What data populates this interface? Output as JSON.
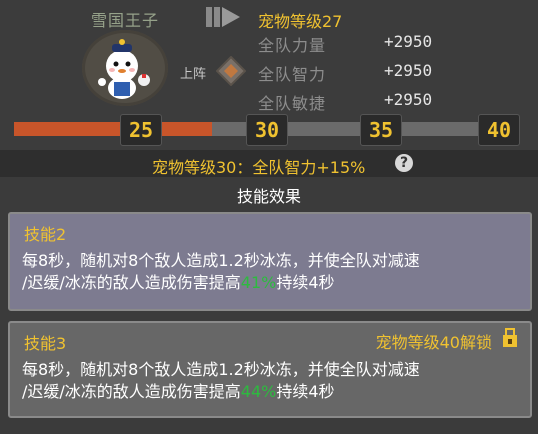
{
  "pet": {
    "name": "雪国王子",
    "level_label": "宠物等级27",
    "deploy_label": "上阵"
  },
  "stats": [
    {
      "label": "全队力量",
      "value": "+2950"
    },
    {
      "label": "全队智力",
      "value": "+2950"
    },
    {
      "label": "全队敏捷",
      "value": "+2950"
    }
  ],
  "milestones": [
    "25",
    "30",
    "35",
    "40"
  ],
  "progress": {
    "segment_1": 1.0,
    "segment_2": 0.6,
    "segment_3": 0.0,
    "segment_4": 0.0
  },
  "banner": {
    "text": "宠物等级30：全队智力+15%"
  },
  "section": {
    "title": "技能效果"
  },
  "skills": [
    {
      "name": "技能2",
      "desc_line1": "每8秒，随机对8个敌人造成1.2秒冰冻，并使全队对减速",
      "desc_line2_a": "/迟缓/冰冻的敌人造成伤害提高",
      "highlight": "41%",
      "desc_line2_b": "持续4秒"
    },
    {
      "name": "技能3",
      "unlock_label": "宠物等级40解锁",
      "desc_line1": "每8秒，随机对8个敌人造成1.2秒冰冻，并使全队对减速",
      "desc_line2_a": "/迟缓/冰冻的敌人造成伤害提高",
      "highlight": "44%",
      "desc_line2_b": "持续4秒"
    }
  ],
  "colors": {
    "gold": "#f0c230",
    "bar_fill": "#c8552a",
    "highlight_green": "#2dbb3f",
    "card_active": "#7d7b90"
  }
}
